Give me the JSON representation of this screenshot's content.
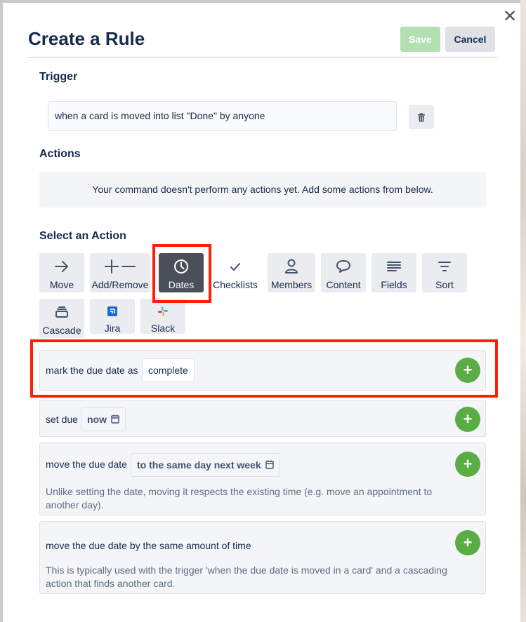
{
  "dialog": {
    "title": "Create a Rule",
    "save_label": "Save",
    "cancel_label": "Cancel",
    "close_label": "✕"
  },
  "trigger": {
    "heading": "Trigger",
    "text": "when a card is moved into list \"Done\" by anyone"
  },
  "actions": {
    "heading": "Actions",
    "empty_message": "Your command doesn't perform any actions yet. Add some actions from below."
  },
  "select_action": {
    "heading": "Select an Action",
    "selected": "Dates",
    "tiles": [
      {
        "label": "Move",
        "icon": "arrow-right-icon"
      },
      {
        "label": "Add/Remove",
        "icon": "plus-minus-icon"
      },
      {
        "label": "Dates",
        "icon": "clock-icon"
      },
      {
        "label": "Checklists",
        "icon": "checkmark-icon"
      },
      {
        "label": "Members",
        "icon": "person-icon"
      },
      {
        "label": "Content",
        "icon": "speech-bubble-icon"
      },
      {
        "label": "Fields",
        "icon": "lines-icon"
      },
      {
        "label": "Sort",
        "icon": "sort-icon"
      },
      {
        "label": "Cascade",
        "icon": "stack-icon"
      },
      {
        "label": "Jira",
        "icon": "jira-icon"
      },
      {
        "label": "Slack",
        "icon": "slack-icon"
      }
    ]
  },
  "date_actions": [
    {
      "prefix": "mark the due date as",
      "value": "complete"
    },
    {
      "prefix": "set due",
      "value": "now"
    },
    {
      "prefix": "move the due date",
      "value": "to the same day next week",
      "description": "Unlike setting the date, moving it respects the existing time (e.g. move an appointment to another day)."
    },
    {
      "prefix": "move the due date by the same amount of time",
      "description": "This is typically used with the trigger 'when the due date is moved in a card' and a cascading action that finds another card."
    }
  ],
  "colors": {
    "accent_green": "#5aac44",
    "highlight_red": "#ff1e0a",
    "selected_tile": "#4a4f5a",
    "save_disabled": "#b3dfb3"
  }
}
